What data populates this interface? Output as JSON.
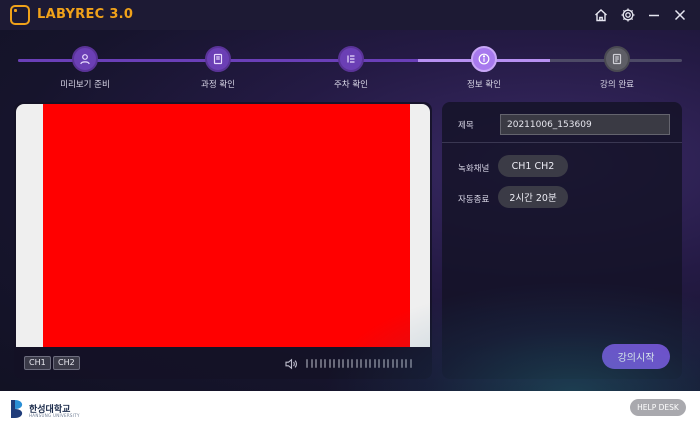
{
  "app": {
    "title": "LABYREC 3.0"
  },
  "titlebar": {
    "icons": [
      "home-icon",
      "gear-icon",
      "minimize-icon",
      "close-icon"
    ]
  },
  "steps": [
    {
      "label": "미리보기 준비",
      "icon": "user-icon",
      "state": "done"
    },
    {
      "label": "과정 확인",
      "icon": "book-icon",
      "state": "done"
    },
    {
      "label": "주차 확인",
      "icon": "list-icon",
      "state": "done"
    },
    {
      "label": "정보 확인",
      "icon": "info-icon",
      "state": "active"
    },
    {
      "label": "강의 완료",
      "icon": "document-icon",
      "state": "todo"
    }
  ],
  "preview": {
    "ch1_label": "CH1",
    "ch2_label": "CH2"
  },
  "info": {
    "title_label": "제목",
    "title_value": "20211006_153609",
    "channel_label": "녹화채널",
    "channel_value": "CH1  CH2",
    "auto_end_label": "자동종료",
    "auto_end_value": "2시간 20분",
    "start_button": "강의시작"
  },
  "footer": {
    "university_name": "한성대학교",
    "university_sub": "HANSUNG UNIVERSITY",
    "help_button": "HELP DESK"
  },
  "colors": {
    "accent": "#7a4ed6",
    "brand": "#f0a21a",
    "video": "#ff0000"
  }
}
